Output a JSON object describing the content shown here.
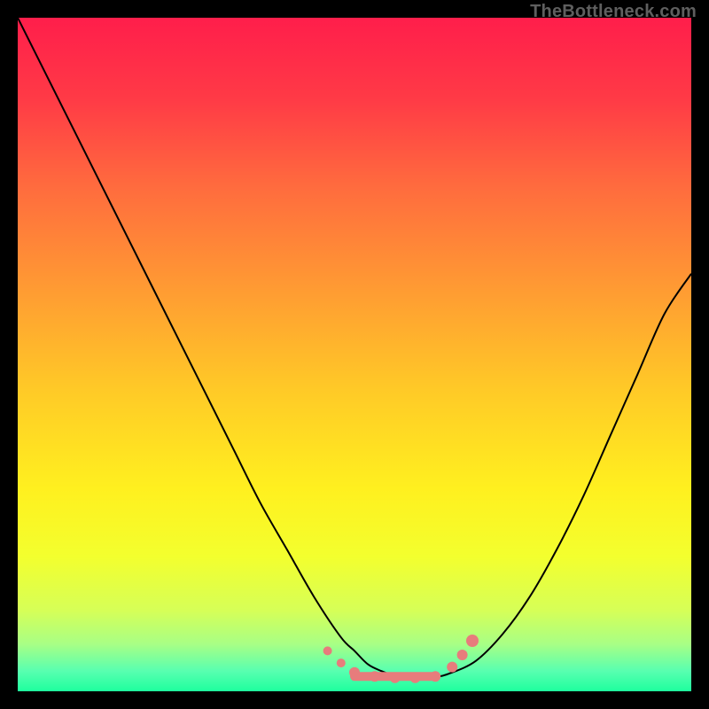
{
  "watermark": "TheBottleneck.com",
  "chart_data": {
    "type": "line",
    "title": "",
    "xlabel": "",
    "ylabel": "",
    "xlim": [
      0,
      100
    ],
    "ylim": [
      0,
      100
    ],
    "background": {
      "gradient_stops": [
        {
          "pos": 0.0,
          "color": "#ff1e4b"
        },
        {
          "pos": 0.12,
          "color": "#ff3a46"
        },
        {
          "pos": 0.25,
          "color": "#ff6b3e"
        },
        {
          "pos": 0.4,
          "color": "#ff9a33"
        },
        {
          "pos": 0.55,
          "color": "#ffc927"
        },
        {
          "pos": 0.7,
          "color": "#fff01f"
        },
        {
          "pos": 0.8,
          "color": "#f3ff2e"
        },
        {
          "pos": 0.88,
          "color": "#d6ff57"
        },
        {
          "pos": 0.93,
          "color": "#a8ff85"
        },
        {
          "pos": 0.97,
          "color": "#58ffb0"
        },
        {
          "pos": 1.0,
          "color": "#1eff9e"
        }
      ]
    },
    "series": [
      {
        "name": "bottleneck-curve",
        "stroke": "#000000",
        "stroke_width": 2,
        "x": [
          0,
          4,
          8,
          12,
          16,
          20,
          24,
          28,
          32,
          36,
          40,
          44,
          48,
          50,
          52,
          54,
          56,
          58,
          60,
          62,
          64,
          68,
          72,
          76,
          80,
          84,
          88,
          92,
          96,
          100
        ],
        "y": [
          100,
          92,
          84,
          76,
          68,
          60,
          52,
          44,
          36,
          28,
          21,
          14,
          8,
          6,
          4,
          3,
          2.3,
          2.0,
          2.0,
          2.1,
          2.6,
          4.5,
          8.5,
          14,
          21,
          29,
          38,
          47,
          56,
          62
        ]
      }
    ],
    "markers": {
      "name": "highlight-dots",
      "color": "#e77c7c",
      "radius_small": 5,
      "radius_large": 7,
      "stroke_segment": {
        "stroke": "#e77c7c",
        "stroke_width": 10,
        "x": [
          50,
          62
        ],
        "y": [
          2.2,
          2.2
        ]
      },
      "points": [
        {
          "x": 46.0,
          "y": 6.0,
          "r": 5
        },
        {
          "x": 48.0,
          "y": 4.2,
          "r": 5
        },
        {
          "x": 50.0,
          "y": 2.8,
          "r": 6
        },
        {
          "x": 53.0,
          "y": 2.2,
          "r": 6
        },
        {
          "x": 56.0,
          "y": 2.0,
          "r": 6
        },
        {
          "x": 59.0,
          "y": 2.0,
          "r": 6
        },
        {
          "x": 62.0,
          "y": 2.2,
          "r": 6
        },
        {
          "x": 64.5,
          "y": 3.6,
          "r": 6
        },
        {
          "x": 66.0,
          "y": 5.4,
          "r": 6
        },
        {
          "x": 67.5,
          "y": 7.5,
          "r": 7
        }
      ]
    }
  }
}
